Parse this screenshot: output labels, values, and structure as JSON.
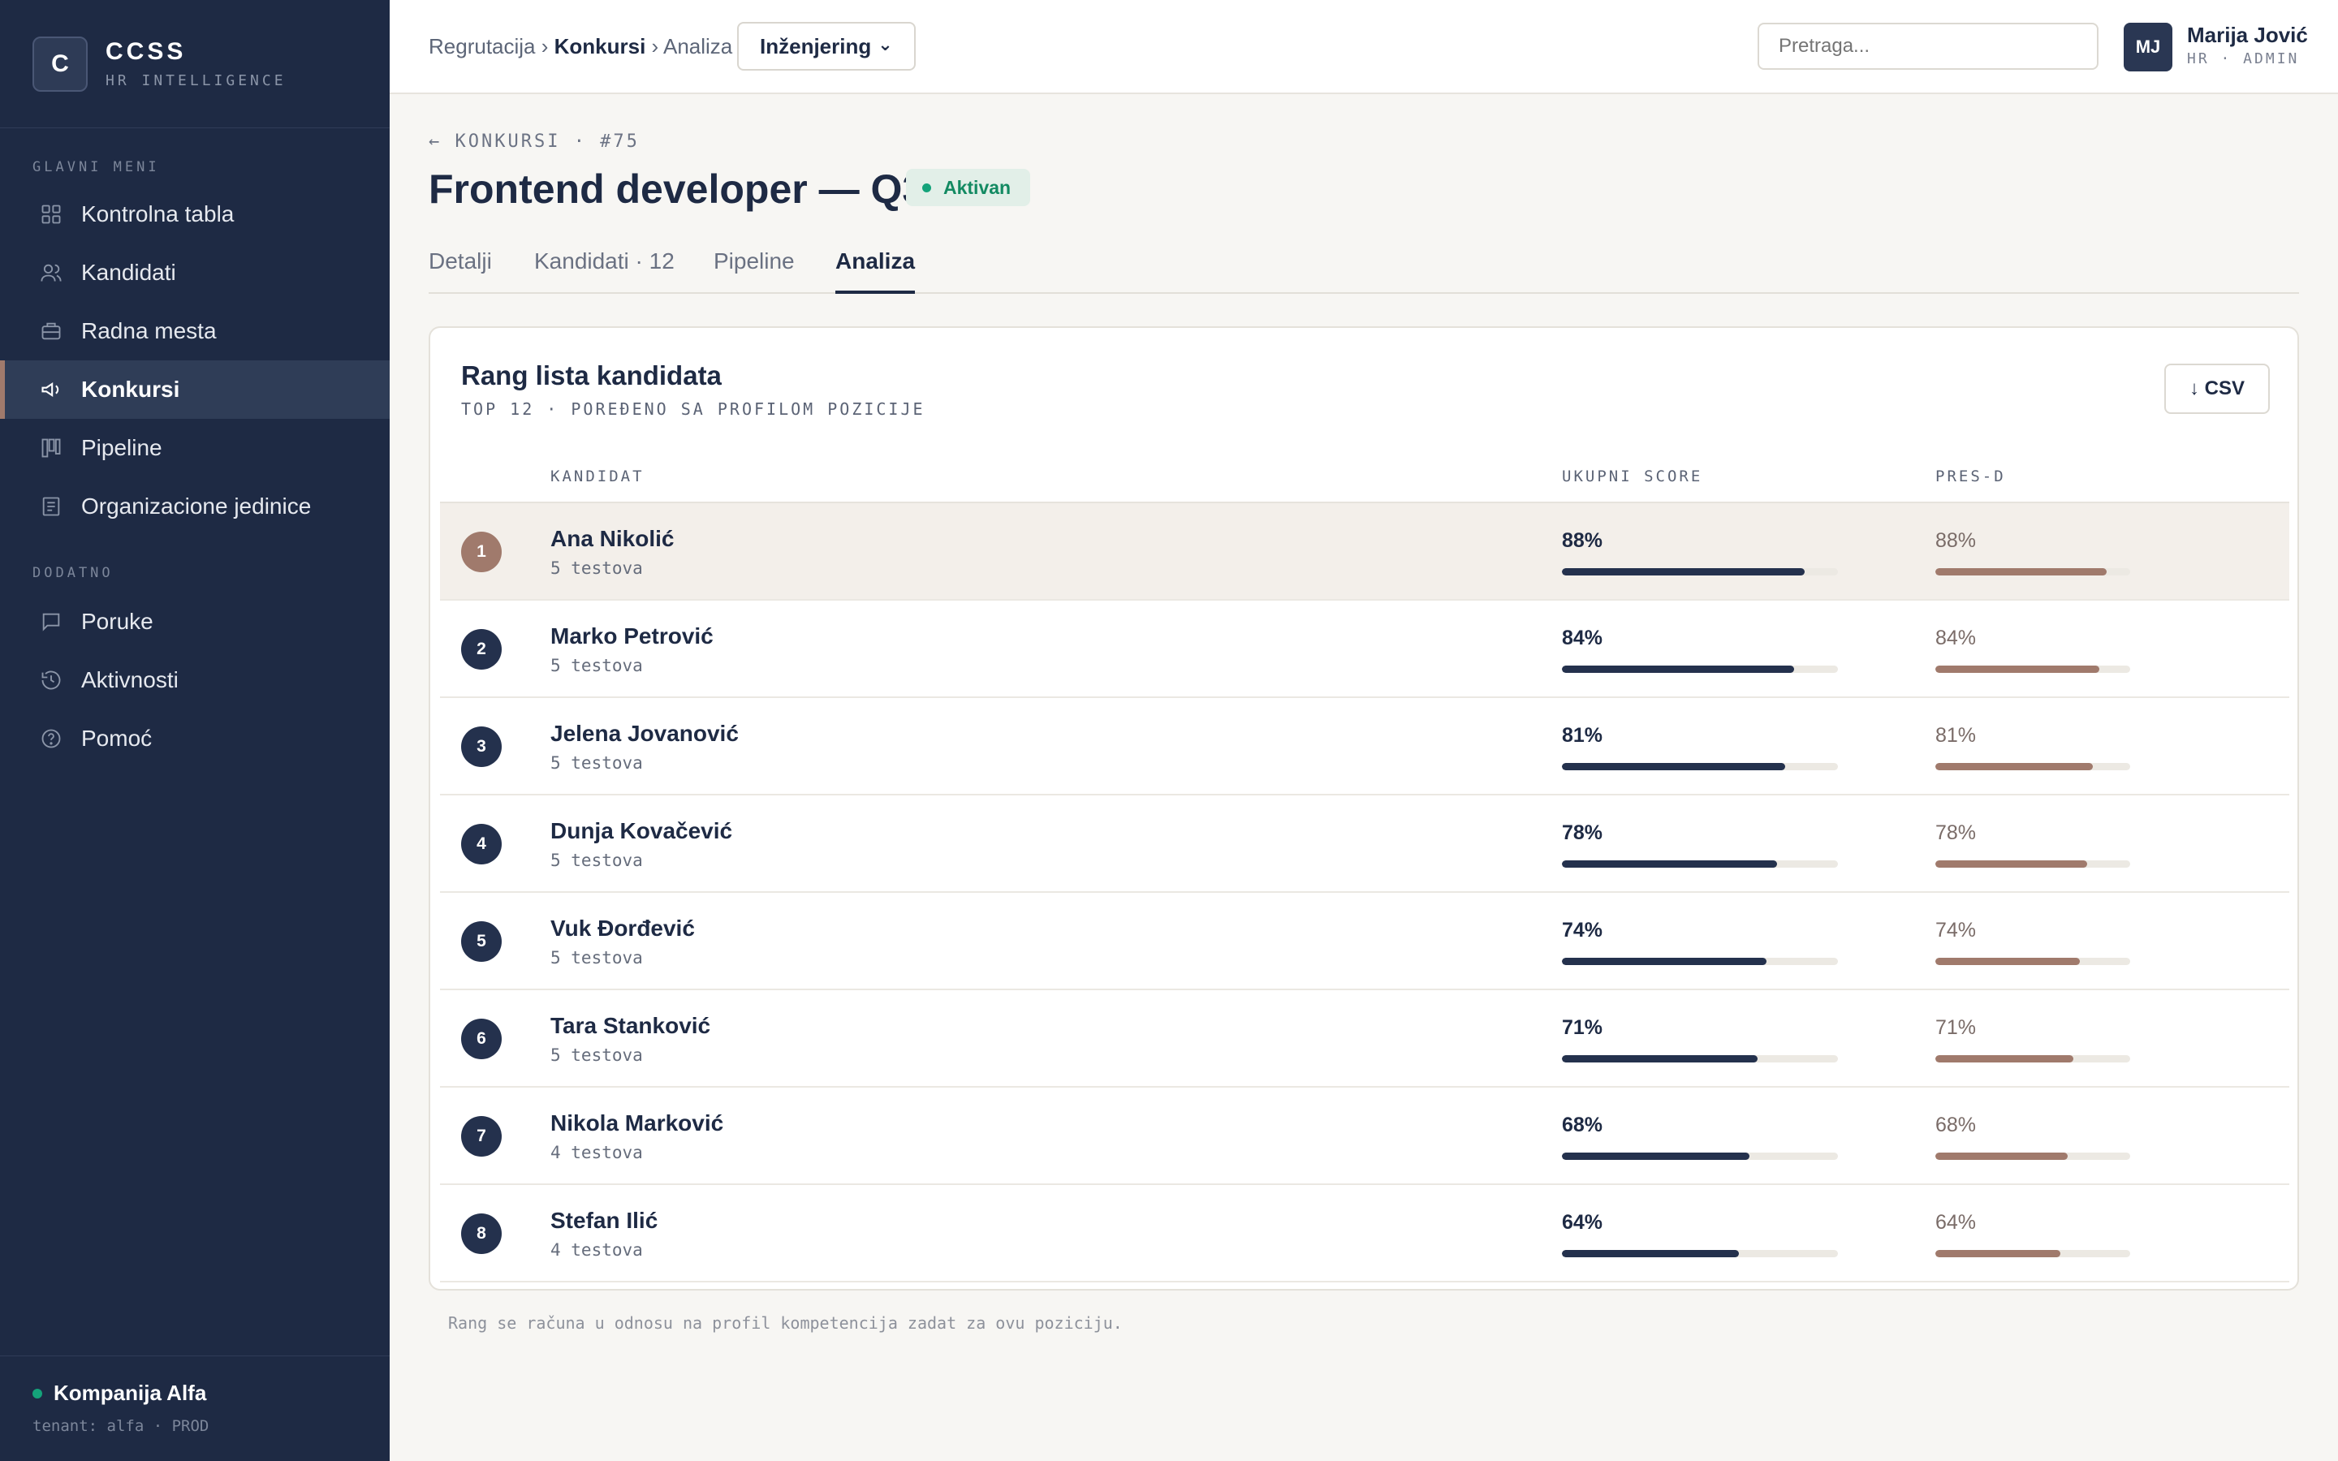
{
  "brand": {
    "logo_letter": "C",
    "name": "CCSS",
    "subtitle": "HR INTELLIGENCE"
  },
  "sidebar": {
    "section_main": "GLAVNI MENI",
    "section_extra": "DODATNO",
    "items": [
      {
        "label": "Kontrolna tabla",
        "icon": "grid-icon"
      },
      {
        "label": "Kandidati",
        "icon": "users-icon"
      },
      {
        "label": "Radna mesta",
        "icon": "briefcase-icon"
      },
      {
        "label": "Konkursi",
        "icon": "megaphone-icon",
        "active": true
      },
      {
        "label": "Pipeline",
        "icon": "kanban-icon"
      },
      {
        "label": "Organizacione jedinice",
        "icon": "document-icon"
      }
    ],
    "extra_items": [
      {
        "label": "Poruke",
        "icon": "message-icon"
      },
      {
        "label": "Aktivnosti",
        "icon": "history-icon"
      },
      {
        "label": "Pomoć",
        "icon": "help-icon"
      }
    ],
    "company": {
      "name": "Kompanija Alfa",
      "tenant": "tenant: alfa · PROD"
    }
  },
  "header": {
    "breadcrumb": {
      "root": "Regrutacija",
      "sep": " › ",
      "mid": "Konkursi",
      "current": "Analiza"
    },
    "department": "Inženjering",
    "dept_caret": "⌄",
    "search_placeholder": "Pretraga...",
    "user": {
      "initials": "MJ",
      "name": "Marija Jović",
      "role": "HR · ADMIN"
    }
  },
  "page": {
    "back": "← KONKURSI · #75",
    "title": "Frontend developer — Q3",
    "status": "Aktivan",
    "tabs": [
      "Detalji",
      "Kandidati · 12",
      "Pipeline",
      "Analiza"
    ],
    "active_tab": "Analiza"
  },
  "ranking": {
    "title": "Rang lista kandidata",
    "subtitle": "TOP 12 · POREĐENO SA PROFILOM POZICIJE",
    "csv_label": "↓ CSV",
    "columns": [
      "KANDIDAT",
      "UKUPNI SCORE",
      "PRES-D"
    ],
    "rows": [
      {
        "rank": "1",
        "name": "Ana Nikolić",
        "tests": "5 testova",
        "score": "88%",
        "pres": "88%",
        "score_value": 88,
        "pres_value": 88
      },
      {
        "rank": "2",
        "name": "Marko Petrović",
        "tests": "5 testova",
        "score": "84%",
        "pres": "84%",
        "score_value": 84,
        "pres_value": 84
      },
      {
        "rank": "3",
        "name": "Jelena Jovanović",
        "tests": "5 testova",
        "score": "81%",
        "pres": "81%",
        "score_value": 81,
        "pres_value": 81
      },
      {
        "rank": "4",
        "name": "Dunja Kovačević",
        "tests": "5 testova",
        "score": "78%",
        "pres": "78%",
        "score_value": 78,
        "pres_value": 78
      },
      {
        "rank": "5",
        "name": "Vuk Đorđević",
        "tests": "5 testova",
        "score": "74%",
        "pres": "74%",
        "score_value": 74,
        "pres_value": 74
      },
      {
        "rank": "6",
        "name": "Tara Stanković",
        "tests": "5 testova",
        "score": "71%",
        "pres": "71%",
        "score_value": 71,
        "pres_value": 71
      },
      {
        "rank": "7",
        "name": "Nikola Marković",
        "tests": "4 testova",
        "score": "68%",
        "pres": "68%",
        "score_value": 68,
        "pres_value": 68
      },
      {
        "rank": "8",
        "name": "Stefan Ilić",
        "tests": "4 testova",
        "score": "64%",
        "pres": "64%",
        "score_value": 64,
        "pres_value": 64
      }
    ],
    "footnote": "Rang se računa u odnosu na profil kompetencija zadat za ovu poziciju."
  },
  "colors": {
    "navy": "#1e2a44",
    "accent": "#a07a6c",
    "success": "#14a37a"
  }
}
